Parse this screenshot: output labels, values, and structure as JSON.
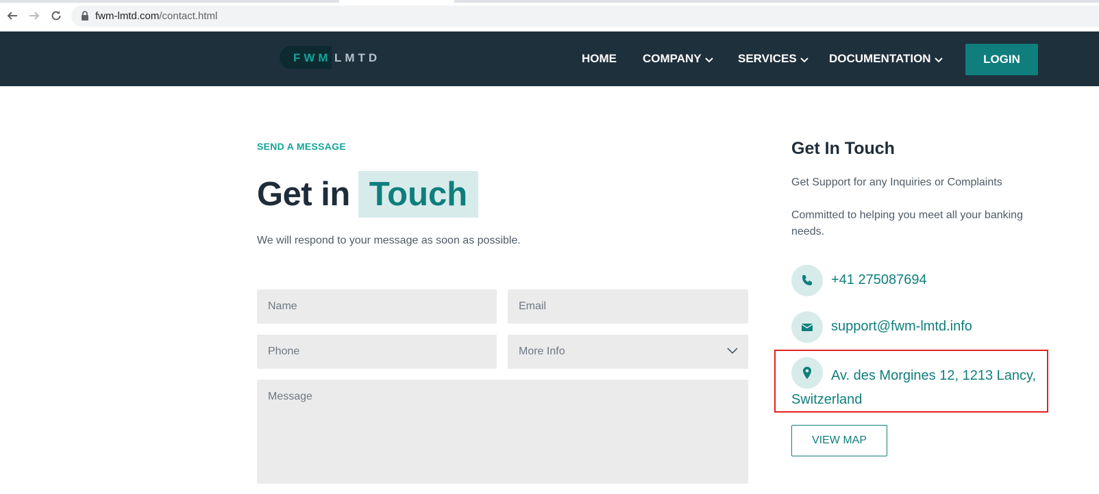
{
  "browser": {
    "url_host": "fwm-lmtd.com",
    "url_path": "/contact.html"
  },
  "header": {
    "logo_part1": "FWM",
    "logo_part2": "LMTD",
    "nav": [
      {
        "label": "HOME",
        "has_dropdown": false
      },
      {
        "label": "COMPANY",
        "has_dropdown": true
      },
      {
        "label": "SERVICES",
        "has_dropdown": true
      },
      {
        "label": "DOCUMENTATION",
        "has_dropdown": true
      }
    ],
    "login_label": "LOGIN"
  },
  "form_section": {
    "eyebrow": "SEND A MESSAGE",
    "title_main": "Get in",
    "title_highlight": "Touch",
    "subtext": "We will respond to your message as soon as possible.",
    "fields": {
      "name_placeholder": "Name",
      "email_placeholder": "Email",
      "phone_placeholder": "Phone",
      "more_info_selected": "More Info",
      "message_placeholder": "Message"
    }
  },
  "contact_info": {
    "title": "Get In Touch",
    "line1": "Get Support for any Inquiries or Complaints",
    "line2": "Committed to helping you meet all your banking needs.",
    "phone": "+41 275087694",
    "email": "support@fwm-lmtd.info",
    "address": "Av. des Morgines 12, 1213 Lancy, Switzerland",
    "view_map_label": "VIEW MAP"
  },
  "colors": {
    "header_bg": "#1f303d",
    "accent": "#0f7e7d",
    "accent_light": "#d7ebea",
    "field_bg": "#ebebeb",
    "highlight_box": "#e51f1f"
  }
}
